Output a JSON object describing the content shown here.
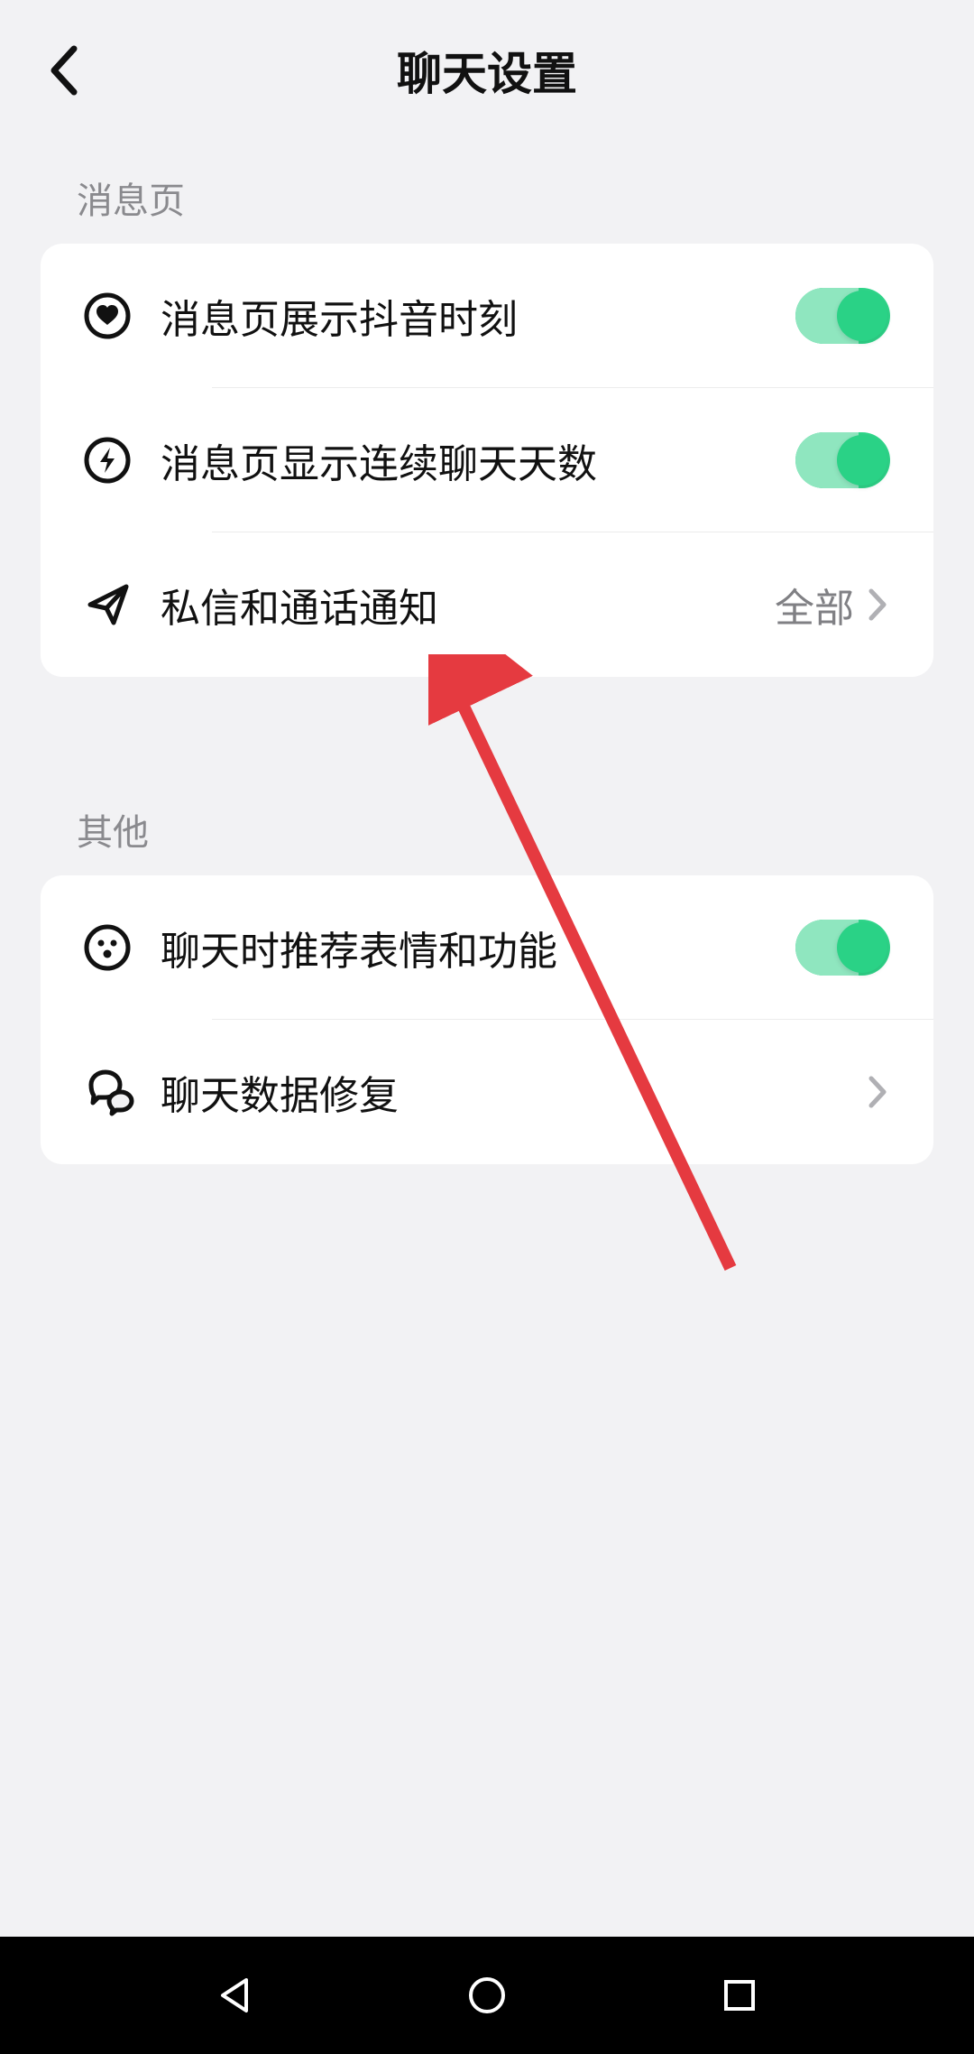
{
  "header": {
    "title": "聊天设置"
  },
  "sections": {
    "message_page": {
      "header": "消息页",
      "rows": {
        "show_douyin_moments": {
          "label": "消息页展示抖音时刻",
          "toggle_on": true
        },
        "show_continuous_days": {
          "label": "消息页显示连续聊天天数",
          "toggle_on": true
        },
        "dm_call_notify": {
          "label": "私信和通话通知",
          "value": "全部"
        }
      }
    },
    "other": {
      "header": "其他",
      "rows": {
        "recommend_emoji": {
          "label": "聊天时推荐表情和功能",
          "toggle_on": true
        },
        "data_repair": {
          "label": "聊天数据修复"
        }
      }
    }
  }
}
